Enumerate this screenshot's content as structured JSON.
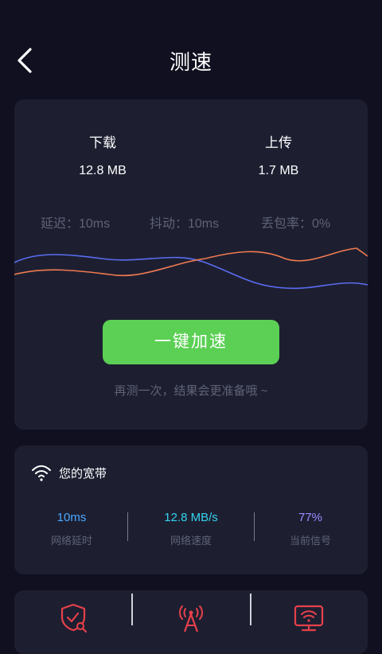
{
  "header": {
    "title": "测速",
    "back_icon": "chevron-left-icon"
  },
  "speed": {
    "download_label": "下载",
    "download_value": "12.8 MB",
    "upload_label": "上传",
    "upload_value": "1.7 MB",
    "latency": "延迟：10ms",
    "jitter": "抖动：10ms",
    "packet_loss": "丢包率：0%",
    "boost_button": "一键加速",
    "hint": "再测一次，结果会更准备哦 ~",
    "wave_colors": {
      "download": "#5b6cf0",
      "upload": "#f07a50"
    }
  },
  "broadband": {
    "title": "您的宽带",
    "icon": "wifi-icon",
    "stats": [
      {
        "value": "10ms",
        "label": "网络延时",
        "color": "#4aa8ff"
      },
      {
        "value": "12.8 MB/s",
        "label": "网络速度",
        "color": "#36d3ee"
      },
      {
        "value": "77%",
        "label": "当前信号",
        "color": "#9a8cff"
      }
    ]
  },
  "tools": [
    {
      "icon": "shield-search-icon"
    },
    {
      "icon": "signal-tower-icon"
    },
    {
      "icon": "monitor-wifi-icon"
    }
  ],
  "colors": {
    "background": "#101020",
    "card": "#1d1f31",
    "accent_green": "#5bd054",
    "tool_red": "#e8404a"
  }
}
